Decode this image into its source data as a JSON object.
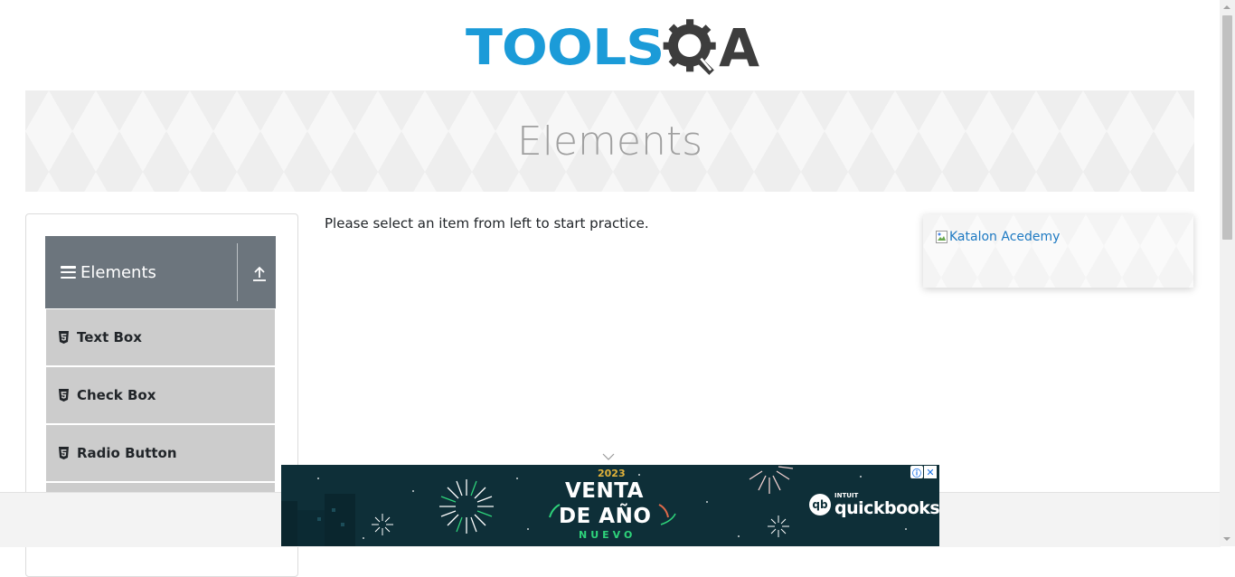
{
  "header": {
    "logo_text_main": "TOOLS",
    "logo_text_end": "A",
    "logo_colors": {
      "tools": "#1b9bd8",
      "qa": "#3d3d3d"
    }
  },
  "banner": {
    "title": "Elements"
  },
  "sidebar": {
    "group": {
      "title": "Elements",
      "toggle_icon": "upload-arrow-icon"
    },
    "items": [
      {
        "label": "Text Box",
        "icon": "html5-icon"
      },
      {
        "label": "Check Box",
        "icon": "html5-icon"
      },
      {
        "label": "Radio Button",
        "icon": "html5-icon"
      }
    ]
  },
  "main": {
    "message": "Please select an item from left to start practice."
  },
  "side_ad": {
    "alt_text": "Katalon Acedemy"
  },
  "ad_banner": {
    "year": "2023",
    "line1": "VENTA",
    "line2": "DE AÑO",
    "line3": "NUEVO",
    "brand_small": "INTUIT",
    "brand_name": "quickbooks",
    "brand_mark": "qb",
    "info_glyph": "ⓘ",
    "close_glyph": "✕",
    "colors": {
      "background": "#0e2f38",
      "accent": "#e1b23a",
      "green": "#2ed37a"
    }
  },
  "colors": {
    "group_header": "#6c757d",
    "menu_item": "#cccccc",
    "link": "#1d79c2"
  }
}
